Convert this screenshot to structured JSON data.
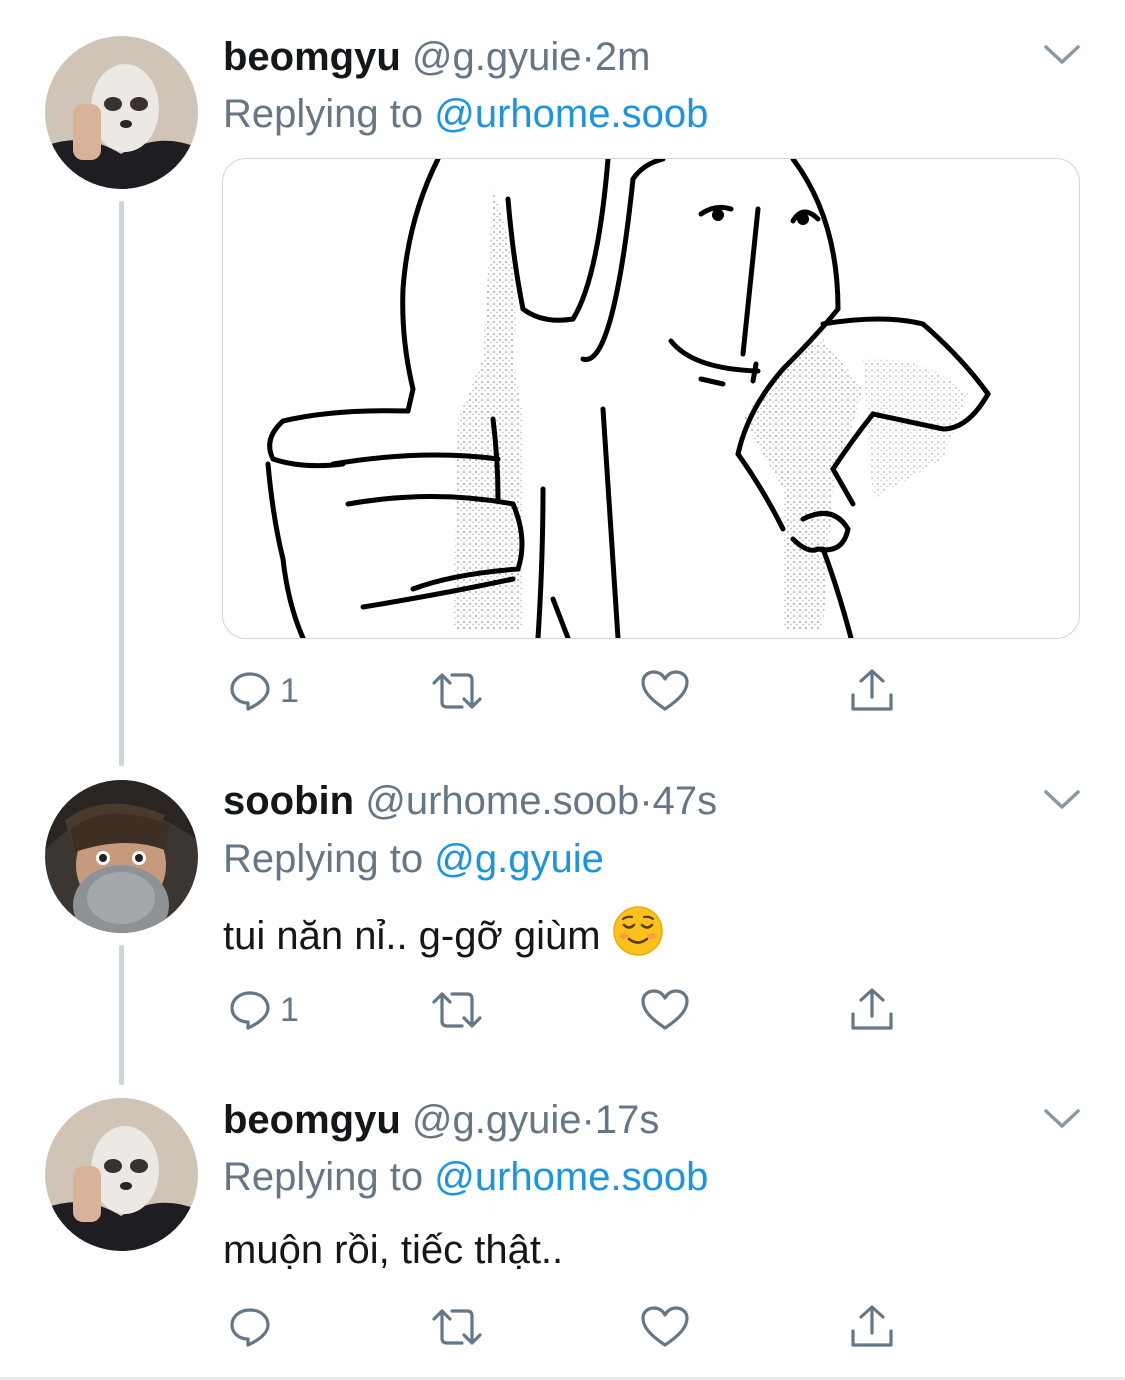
{
  "tweets": [
    {
      "name": "beomgyu",
      "handle": "@g.gyuie",
      "separator": "·",
      "time": "2m",
      "replying_prefix": "Replying to",
      "replying_to": "@urhome.soob",
      "reply_count": "1"
    },
    {
      "name": "soobin",
      "handle": "@urhome.soob",
      "separator": "·",
      "time": "47s",
      "replying_prefix": "Replying to",
      "replying_to": "@g.gyuie",
      "text": "tui năn nỉ.. g-gỡ giùm",
      "emoji": "relieved-smiling-face",
      "reply_count": "1"
    },
    {
      "name": "beomgyu",
      "handle": "@g.gyuie",
      "separator": "·",
      "time": "17s",
      "replying_prefix": "Replying to",
      "replying_to": "@urhome.soob",
      "text": "muộn rồi, tiếc thật..",
      "reply_count": ""
    }
  ],
  "colors": {
    "link": "#1b95e0",
    "meta": "#657786",
    "icon": "#657786",
    "thread_line": "#ccd6dd",
    "name": "#14171a"
  },
  "icons": [
    "reply-icon",
    "retweet-icon",
    "like-icon",
    "share-icon",
    "chevron-down-icon"
  ]
}
